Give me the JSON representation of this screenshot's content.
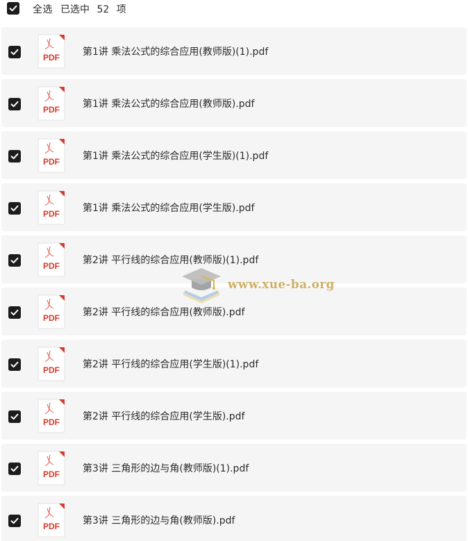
{
  "header": {
    "select_all_label": "全选",
    "selected_prefix": "已选中",
    "selected_count": "52",
    "selected_suffix": "项",
    "all_checked": true
  },
  "file_icon": {
    "label": "PDF",
    "icon": "pdf-file-icon",
    "accent_color": "#d93a2b"
  },
  "files": [
    {
      "name": "第1讲 乘法公式的综合应用(教师版)(1).pdf",
      "checked": true
    },
    {
      "name": "第1讲 乘法公式的综合应用(教师版).pdf",
      "checked": true
    },
    {
      "name": "第1讲 乘法公式的综合应用(学生版)(1).pdf",
      "checked": true
    },
    {
      "name": "第1讲 乘法公式的综合应用(学生版).pdf",
      "checked": true
    },
    {
      "name": "第2讲 平行线的综合应用(教师版)(1).pdf",
      "checked": true
    },
    {
      "name": "第2讲 平行线的综合应用(教师版).pdf",
      "checked": true
    },
    {
      "name": "第2讲 平行线的综合应用(学生版)(1).pdf",
      "checked": true
    },
    {
      "name": "第2讲 平行线的综合应用(学生版).pdf",
      "checked": true
    },
    {
      "name": "第3讲 三角形的边与角(教师版)(1).pdf",
      "checked": true
    },
    {
      "name": "第3讲 三角形的边与角(教师版).pdf",
      "checked": true
    }
  ],
  "watermark": {
    "text": "www.xue-ba.org",
    "icon": "graduation-cap-icon"
  }
}
